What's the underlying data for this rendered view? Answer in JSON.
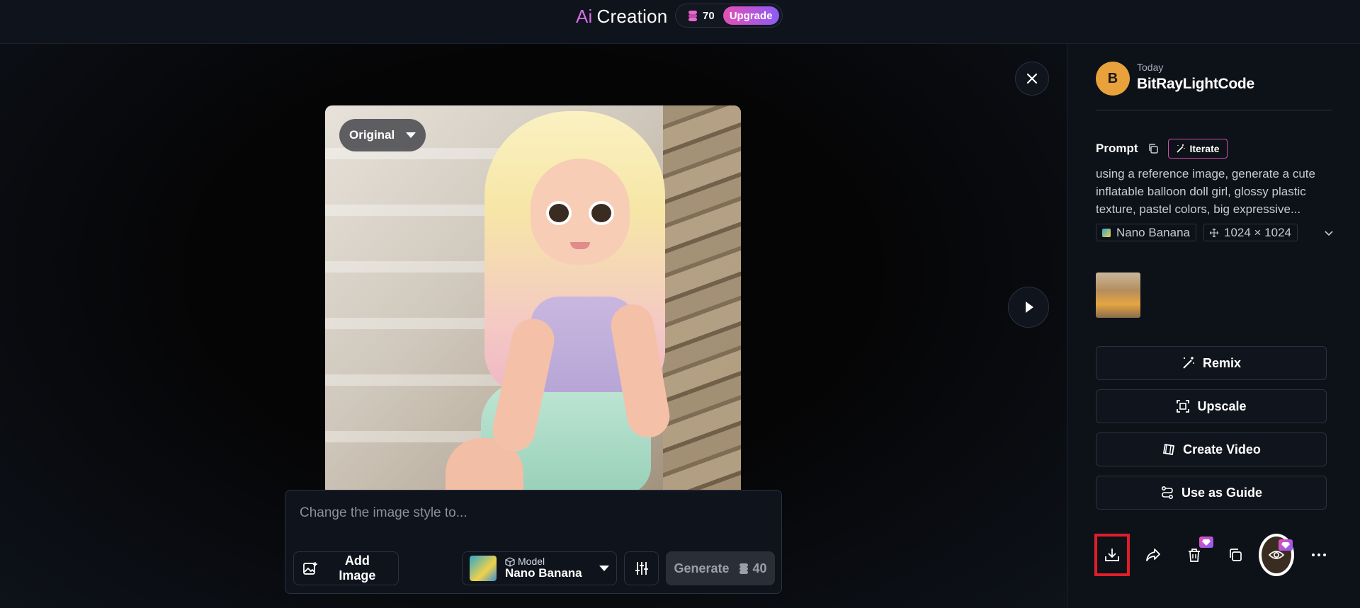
{
  "header": {
    "brand_prefix": "Ai",
    "brand_name": "Creation",
    "credits": "70",
    "upgrade_label": "Upgrade"
  },
  "viewer": {
    "version_label": "Original",
    "close_icon": "close-icon",
    "next_icon": "play-next-icon"
  },
  "composer": {
    "placeholder": "Change the image style to...",
    "add_image_label": "Add Image",
    "model_caption": "Model",
    "model_name": "Nano Banana",
    "generate_label": "Generate",
    "generate_cost": "40"
  },
  "panel": {
    "avatar_letter": "B",
    "date": "Today",
    "username": "BitRayLightCode",
    "prompt_title": "Prompt",
    "iterate_label": "Iterate",
    "prompt_text": "using a reference image, generate a cute inflatable balloon doll girl, glossy plastic texture, pastel colors, big expressive...",
    "tags": {
      "model": "Nano Banana",
      "size": "1024 × 1024"
    },
    "actions": {
      "remix": "Remix",
      "upscale": "Upscale",
      "create_video": "Create Video",
      "use_as_guide": "Use as Guide"
    }
  },
  "colors": {
    "accent_pink": "#d36ee6",
    "upgrade_gradient_start": "#e64fb5",
    "upgrade_gradient_end": "#8b5cf6",
    "avatar": "#e9a23b",
    "highlight_red": "#e01e2a"
  }
}
